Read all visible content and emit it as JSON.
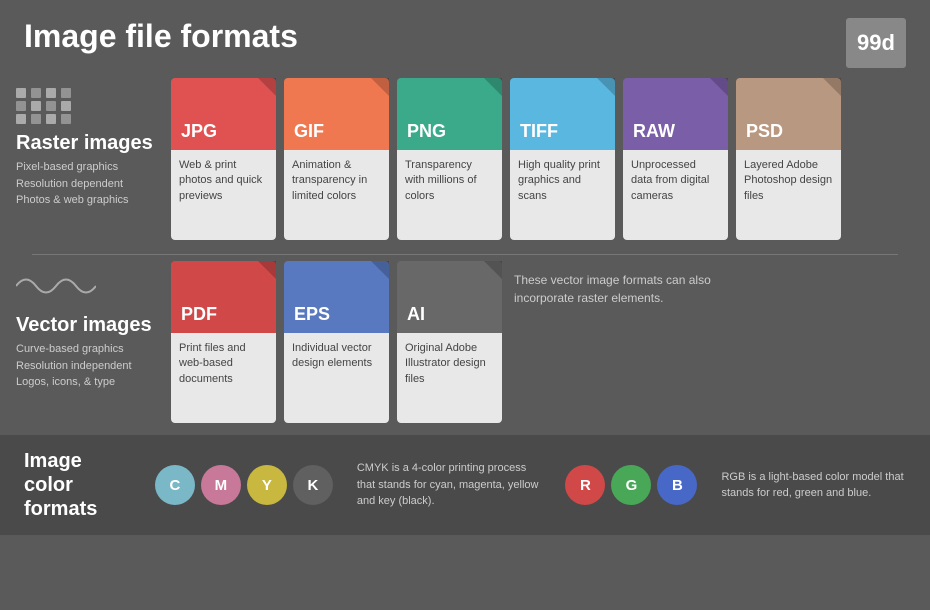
{
  "header": {
    "title": "Image file formats",
    "logo": "99d"
  },
  "raster": {
    "title": "Raster images",
    "desc_lines": [
      "Pixel-based graphics",
      "Resolution dependent",
      "Photos & web graphics"
    ],
    "cards": [
      {
        "label": "JPG",
        "color": "color-red",
        "desc": "Web & print photos and quick previews"
      },
      {
        "label": "GIF",
        "color": "color-orange",
        "desc": "Animation & transparency in limited colors"
      },
      {
        "label": "PNG",
        "color": "color-teal",
        "desc": "Transparency with millions of colors"
      },
      {
        "label": "TIFF",
        "color": "color-blue-light",
        "desc": "High quality print graphics and scans"
      },
      {
        "label": "RAW",
        "color": "color-purple",
        "desc": "Unprocessed data from digital cameras"
      },
      {
        "label": "PSD",
        "color": "color-tan",
        "desc": "Layered Adobe Photoshop design files"
      }
    ]
  },
  "vector": {
    "title": "Vector images",
    "desc_lines": [
      "Curve-based graphics",
      "Resolution independent",
      "Logos, icons, & type"
    ],
    "cards": [
      {
        "label": "PDF",
        "color": "color-red2",
        "desc": "Print files and web-based documents"
      },
      {
        "label": "EPS",
        "color": "color-blue2",
        "desc": "Individual vector design elements"
      },
      {
        "label": "AI",
        "color": "color-dark",
        "desc": "Original Adobe Illustrator design files"
      }
    ],
    "note": "These vector image formats can also incorporate raster elements."
  },
  "color_formats": {
    "title": "Image color formats",
    "cmyk": {
      "desc": "CMYK is a 4-color printing process that stands for cyan, magenta, yellow and key (black).",
      "circles": [
        {
          "letter": "C",
          "class": "c-cyan"
        },
        {
          "letter": "M",
          "class": "c-magenta"
        },
        {
          "letter": "Y",
          "class": "c-yellow"
        },
        {
          "letter": "K",
          "class": "c-black"
        }
      ]
    },
    "rgb": {
      "desc": "RGB is a light-based color model that stands for red, green and blue.",
      "circles": [
        {
          "letter": "R",
          "class": "c-red"
        },
        {
          "letter": "G",
          "class": "c-green"
        },
        {
          "letter": "B",
          "class": "c-blue"
        }
      ]
    }
  }
}
